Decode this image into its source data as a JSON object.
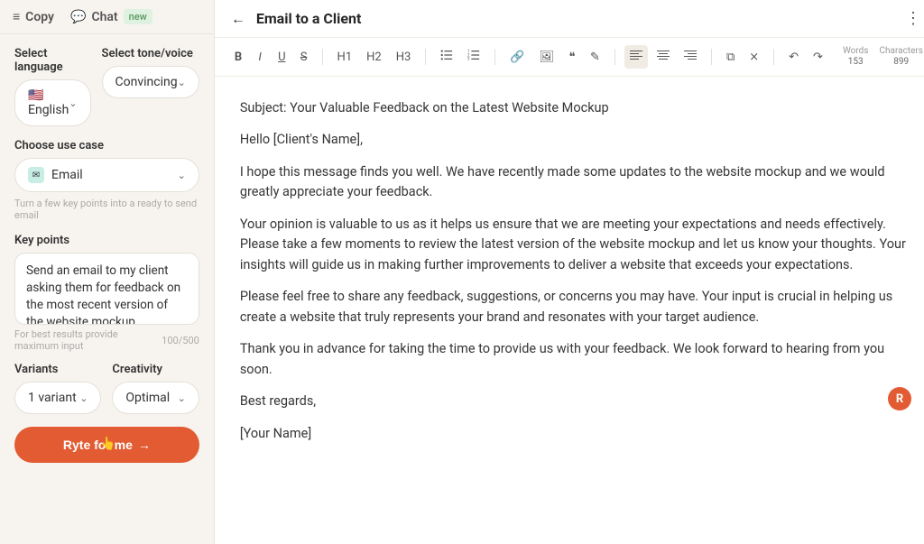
{
  "tabs": {
    "copy": "Copy",
    "chat": "Chat",
    "chat_badge": "new"
  },
  "form": {
    "language_label": "Select language",
    "language_value": "English",
    "tone_label": "Select tone/voice",
    "tone_value": "Convincing",
    "usecase_label": "Choose use case",
    "usecase_value": "Email",
    "usecase_helper": "Turn a few key points into a ready to send email",
    "keypoints_label": "Key points",
    "keypoints_value": "Send an email to my client asking them for feedback on the most recent version of the website mockup",
    "keypoints_helper": "For best results provide maximum input",
    "keypoints_counter": "100/500",
    "variants_label": "Variants",
    "variants_value": "1 variant",
    "creativity_label": "Creativity",
    "creativity_value": "Optimal",
    "cta": "Ryte for me"
  },
  "doc": {
    "title": "Email to a Client",
    "words_label": "Words",
    "words_value": "153",
    "chars_label": "Characters",
    "chars_value": "899"
  },
  "toolbar": {
    "h1": "H1",
    "h2": "H2",
    "h3": "H3"
  },
  "content": {
    "p1": "Subject: Your Valuable Feedback on the Latest Website Mockup",
    "p2": "Hello [Client's Name],",
    "p3": "I hope this message finds you well. We have recently made some updates to the website mockup and we would greatly appreciate your feedback.",
    "p4": "Your opinion is valuable to us as it helps us ensure that we are meeting your expectations and needs effectively. Please take a few moments to review the latest version of the website mockup and let us know your thoughts. Your insights will guide us in making further improvements to deliver a website that exceeds your expectations.",
    "p5": "Please feel free to share any feedback, suggestions, or concerns you may have. Your input is crucial in helping us create a website that truly represents your brand and resonates with your target audience.",
    "p6": "Thank you in advance for taking the time to provide us with your feedback. We look forward to hearing from you soon.",
    "p7": "Best regards,",
    "p8": "[Your Name]"
  },
  "fab": "R"
}
